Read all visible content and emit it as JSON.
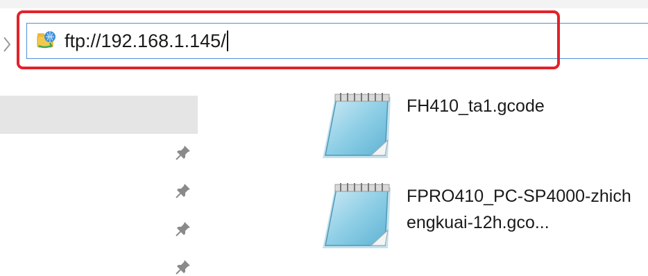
{
  "address_bar": {
    "path": "ftp://192.168.1.145/",
    "icon": "ftp-folder-icon"
  },
  "navigation_pane": {
    "pinned_count": 4,
    "pin_icon": "pin-icon"
  },
  "files": [
    {
      "name": "FH410_ta1.gcode",
      "icon": "notepad-file-icon"
    },
    {
      "name": "FPRO410_PC-SP4000-zhichengkuai-12h.gco...",
      "icon": "notepad-file-icon"
    }
  ],
  "colors": {
    "highlight": "#e2222a",
    "address_border": "#4a90d9",
    "nav_selected": "#e5e5e5"
  }
}
